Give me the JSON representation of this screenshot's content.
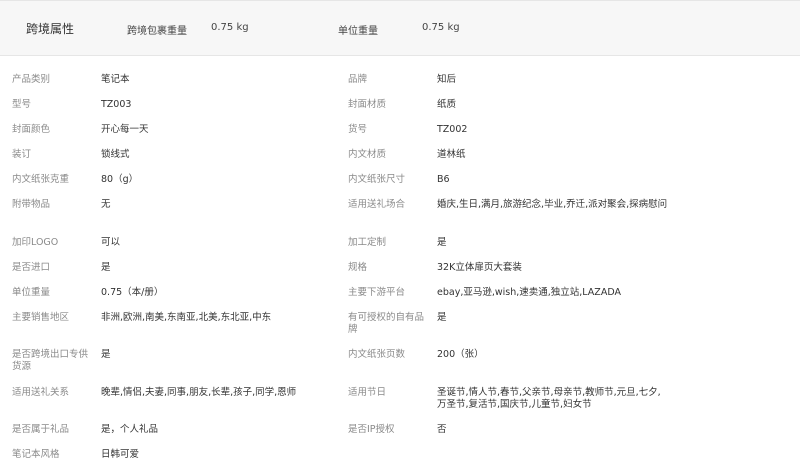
{
  "header": {
    "title": "跨境属性",
    "package_weight_label": "跨境包裹重量",
    "package_weight_value": "0.75 kg",
    "unit_weight_label": "单位重量",
    "unit_weight_value": "0.75 kg"
  },
  "attributes": [
    {
      "left_label": "产品类别",
      "left_value": "笔记本",
      "right_label": "品牌",
      "right_value": "知后"
    },
    {
      "left_label": "型号",
      "left_value": "TZ003",
      "right_label": "封面材质",
      "right_value": "纸质"
    },
    {
      "left_label": "封面颜色",
      "left_value": "开心每一天",
      "right_label": "货号",
      "right_value": "TZ002"
    },
    {
      "left_label": "装订",
      "left_value": "锁线式",
      "right_label": "内文材质",
      "right_value": "道林纸"
    },
    {
      "left_label": "内文纸张克重",
      "left_value": "80（g）",
      "right_label": "内文纸张尺寸",
      "right_value": "B6"
    },
    {
      "left_label": "附带物品",
      "left_value": "无",
      "right_label": "适用送礼场合",
      "right_value": "婚庆,生日,满月,旅游纪念,毕业,乔迁,派对聚会,探病慰问"
    },
    {
      "left_label": "加印LOGO",
      "left_value": "可以",
      "right_label": "加工定制",
      "right_value": "是"
    },
    {
      "left_label": "是否进口",
      "left_value": "是",
      "right_label": "规格",
      "right_value": "32K立体扉页大套装"
    },
    {
      "left_label": "单位重量",
      "left_value": "0.75（本/册）",
      "right_label": "主要下游平台",
      "right_value": "ebay,亚马逊,wish,速卖通,独立站,LAZADA"
    },
    {
      "left_label": "主要销售地区",
      "left_value": "非洲,欧洲,南美,东南亚,北美,东北亚,中东",
      "right_label": "有可授权的自有品牌",
      "right_value": "是"
    },
    {
      "left_label": "是否跨境出口专供货源",
      "left_value": "是",
      "right_label": "内文纸张页数",
      "right_value": "200（张）"
    },
    {
      "left_label": "适用送礼关系",
      "left_value": "晚辈,情侣,夫妻,同事,朋友,长辈,孩子,同学,恩师",
      "right_label": "适用节日",
      "right_value": "圣诞节,情人节,春节,父亲节,母亲节,教师节,元旦,七夕,万圣节,复活节,国庆节,儿童节,妇女节"
    },
    {
      "left_label": "是否属于礼品",
      "left_value": "是，个人礼品",
      "right_label": "是否IP授权",
      "right_value": "否"
    },
    {
      "left_label": "笔记本风格",
      "left_value": "日韩可爱",
      "right_label": "",
      "right_value": ""
    }
  ]
}
